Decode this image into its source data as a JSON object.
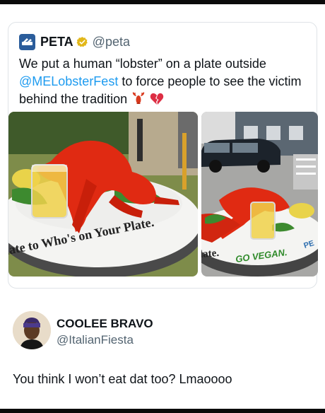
{
  "quoted_post": {
    "name": "PETA",
    "handle": "@peta",
    "text_part1": "We put a human “lobster” on a plate outside ",
    "mention": "@MELobsterFest",
    "text_part2": " to force people to see the victim behind the tradition",
    "emoji_names": [
      "lobster-emoji",
      "broken-heart-emoji"
    ],
    "image_left_plate_text": "late to Who's on Your Plate.",
    "image_right_plate_text_1": "late.",
    "image_right_plate_text_2": "GO VEGAN.",
    "image_right_plate_text_3": "PE"
  },
  "reply": {
    "name": "COOLEE BRAVO",
    "handle": "@ItalianFiesta",
    "text": "You think I won’t eat dat too? Lmaoooo"
  },
  "colors": {
    "mention": "#1d9bf0",
    "secondary_text": "#536471",
    "border": "#dfe3e7",
    "verified_gold": "#e2b719"
  }
}
